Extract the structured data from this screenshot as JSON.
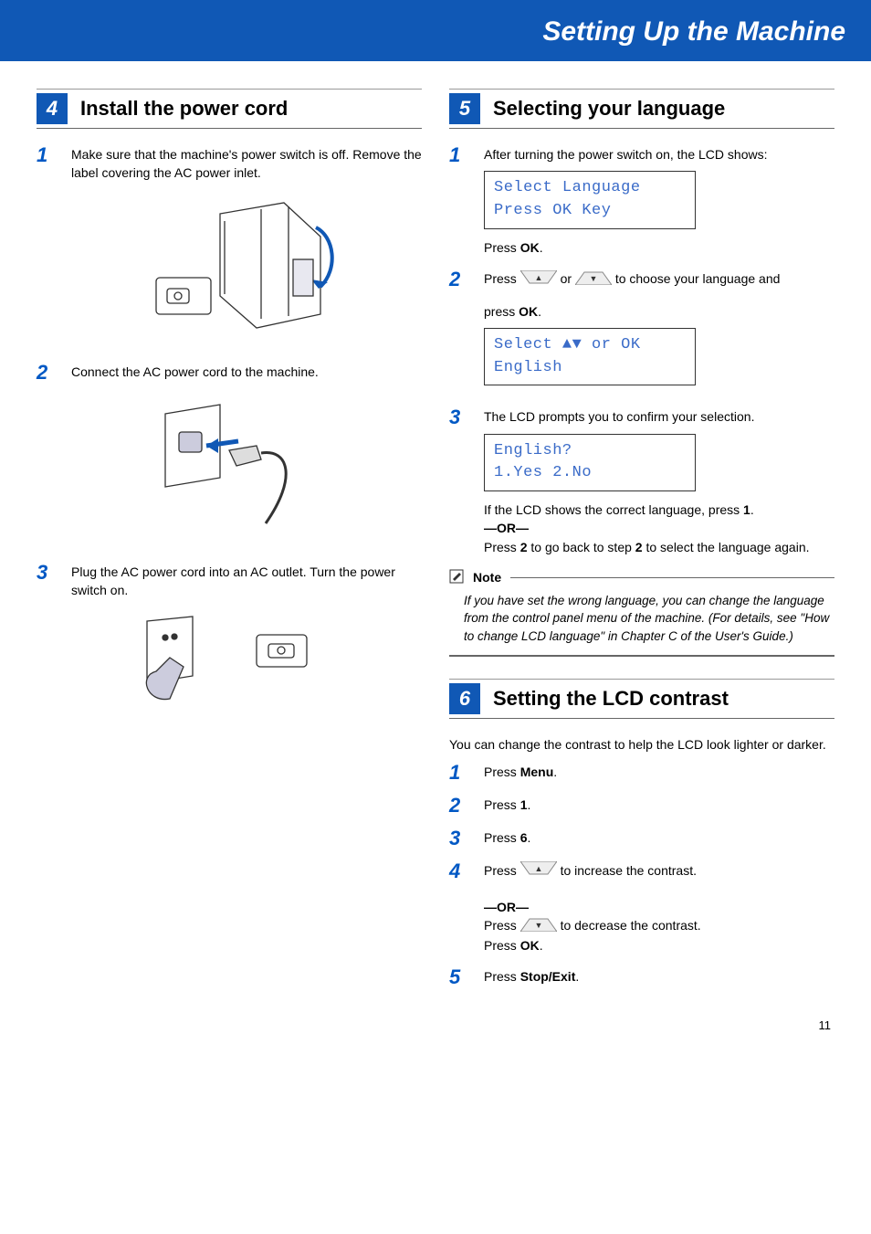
{
  "banner": "Setting Up the Machine",
  "page_number": "11",
  "left": {
    "section_num": "4",
    "section_title": "Install the power cord",
    "steps": [
      {
        "n": "1",
        "text": "Make sure that the machine's power switch is off. Remove the label covering the AC power inlet."
      },
      {
        "n": "2",
        "text": "Connect the AC power cord to the machine."
      },
      {
        "n": "3",
        "text": "Plug the AC power cord into an AC outlet. Turn the power switch on."
      }
    ]
  },
  "right_a": {
    "section_num": "5",
    "section_title": "Selecting your language",
    "step1_text": "After turning the power switch on, the LCD shows:",
    "lcd1": "Select Language\nPress OK Key",
    "press_ok": "Press ",
    "ok_bold": "OK",
    "step2_a": "Press ",
    "step2_b": " or ",
    "step2_c": " to choose your language and",
    "step2_d": "press ",
    "lcd2": "Select ▲▼ or OK\nEnglish",
    "step3_text": "The LCD prompts you to confirm your selection.",
    "lcd3": "English?\n1.Yes 2.No",
    "step3_after_a": "If the LCD shows the correct language, press ",
    "one_bold": "1",
    "or_sep": "—OR—",
    "step3_after_b": "Press ",
    "two_bold": "2",
    "step3_after_c": " to go back to step ",
    "step_ref_bold": "2",
    "step3_after_d": " to select the language again.",
    "note_label": "Note",
    "note_body": "If you have set the wrong language, you can change the language from the control panel menu of the machine. (For details, see \"How to change LCD language\" in Chapter C of the User's Guide.)"
  },
  "right_b": {
    "section_num": "6",
    "section_title": "Setting the LCD contrast",
    "intro": "You can change the contrast to help the LCD look lighter or darker.",
    "steps": {
      "s1a": "Press ",
      "s1b": "Menu",
      "s1c": ".",
      "s2a": "Press ",
      "s2b": "1",
      "s2c": ".",
      "s3a": "Press ",
      "s3b": "6",
      "s3c": ".",
      "s4a": "Press ",
      "s4b": " to increase the contrast.",
      "s4_or": "—OR—",
      "s4c": "Press ",
      "s4d": " to decrease the contrast.",
      "s4e": "Press ",
      "s4f": "OK",
      "s4g": ".",
      "s5a": "Press ",
      "s5b": "Stop/Exit",
      "s5c": "."
    }
  }
}
